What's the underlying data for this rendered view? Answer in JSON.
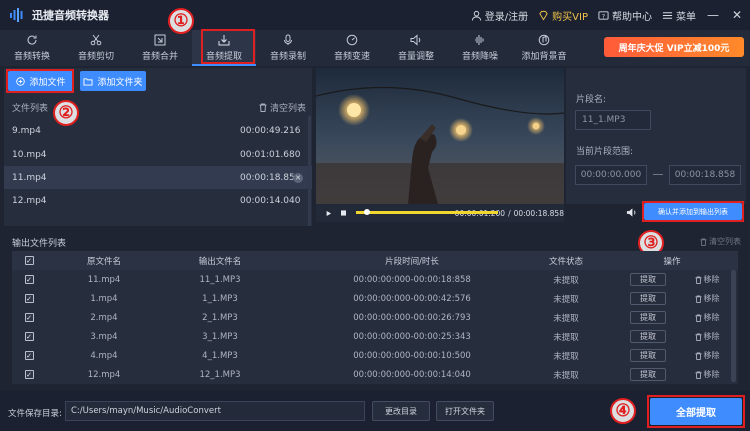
{
  "app": {
    "title": "迅捷音频转换器"
  },
  "titlebar": {
    "login": "登录/注册",
    "vip": "购买VIP",
    "help": "帮助中心",
    "menu": "菜单"
  },
  "toolbar": {
    "items": [
      {
        "label": "音频转换",
        "icon": "refresh-icon"
      },
      {
        "label": "音频剪切",
        "icon": "scissors-icon"
      },
      {
        "label": "音频合并",
        "icon": "merge-icon"
      },
      {
        "label": "音频提取",
        "icon": "extract-icon"
      },
      {
        "label": "音频录制",
        "icon": "microphone-icon"
      },
      {
        "label": "音频变速",
        "icon": "speed-icon"
      },
      {
        "label": "音量调整",
        "icon": "volume-icon"
      },
      {
        "label": "音频降噪",
        "icon": "noise-icon"
      },
      {
        "label": "添加背景音",
        "icon": "music-icon"
      }
    ],
    "active_index": 3,
    "promo": "周年庆大促 VIP立减100元"
  },
  "annotations": {
    "n1": "①",
    "n2": "②",
    "n3": "③",
    "n4": "④"
  },
  "left": {
    "add_file": "添加文件",
    "add_folder": "添加文件夹",
    "list_title": "文件列表",
    "clear_list": "清空列表",
    "files": [
      {
        "name": "9.mp4",
        "duration": "00:00:49.216"
      },
      {
        "name": "10.mp4",
        "duration": "00:01:01.680"
      },
      {
        "name": "11.mp4",
        "duration": "00:00:18.858",
        "selected": true
      },
      {
        "name": "12.mp4",
        "duration": "00:00:14.040"
      }
    ]
  },
  "player": {
    "current_time": "00:00:01.200",
    "separator": "/",
    "total_time": "00:00:18.858",
    "progress_fraction": 0.06
  },
  "segment": {
    "name_label": "片段名:",
    "name_value": "11_1.MP3",
    "range_label": "当前片段范围:",
    "range_start": "00:00:00.000",
    "range_end": "00:00:18.858",
    "confirm_button": "确认并添加到输出列表"
  },
  "output": {
    "title": "输出文件列表",
    "clear": "清空列表",
    "columns": [
      "原文件名",
      "输出文件名",
      "片段时间/时长",
      "文件状态",
      "操作"
    ],
    "extract_label": "提取",
    "remove_label": "移除",
    "rows": [
      {
        "source": "11.mp4",
        "output": "11_1.MP3",
        "time": "00:00:00:000-00:00:18:858",
        "status": "未提取"
      },
      {
        "source": "1.mp4",
        "output": "1_1.MP3",
        "time": "00:00:00:000-00:00:42:576",
        "status": "未提取"
      },
      {
        "source": "2.mp4",
        "output": "2_1.MP3",
        "time": "00:00:00:000-00:00:26:793",
        "status": "未提取"
      },
      {
        "source": "3.mp4",
        "output": "3_1.MP3",
        "time": "00:00:00:000-00:00:25:343",
        "status": "未提取"
      },
      {
        "source": "4.mp4",
        "output": "4_1.MP3",
        "time": "00:00:00:000-00:00:10:500",
        "status": "未提取"
      },
      {
        "source": "12.mp4",
        "output": "12_1.MP3",
        "time": "00:00:00:000-00:00:14:040",
        "status": "未提取"
      }
    ]
  },
  "bottom": {
    "save_label": "文件保存目录:",
    "save_path": "C:/Users/mayn/Music/AudioConvert",
    "change_dir": "更改目录",
    "open_folder": "打开文件夹",
    "extract_all": "全部提取"
  },
  "colors": {
    "accent": "#3f8cff",
    "annotation": "#e02020",
    "vip": "#f0c24a"
  }
}
